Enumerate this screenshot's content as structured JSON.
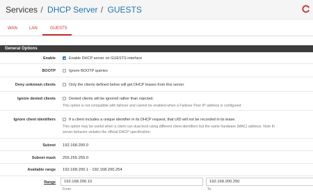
{
  "header": {
    "crumb_services": "Services",
    "crumb_sep": "/",
    "crumb_dhcp": "DHCP Server",
    "crumb_guests": "GUESTS",
    "reload_icon": "reload-icon"
  },
  "tabs": [
    {
      "label": "WAN"
    },
    {
      "label": "LAN"
    },
    {
      "label": "GUESTS"
    }
  ],
  "panel": {
    "title": "General Options"
  },
  "fields": {
    "enable": {
      "label": "Enable",
      "checked": true,
      "text": "Enable DHCP server on GUESTS interface"
    },
    "bootp": {
      "label": "BOOTP",
      "checked": false,
      "text": "Ignore BOOTP queries"
    },
    "deny_unknown": {
      "label": "Deny unknown clients",
      "checked": false,
      "text": "Only the clients defined below will get DHCP leases from this server."
    },
    "ignore_denied": {
      "label": "Ignore denied clients",
      "checked": false,
      "text": "Denied clients will be ignored rather than rejected.",
      "help": "This option is not compatible with failover and cannot be enabled when a Failover Peer IP address is configured."
    },
    "ignore_client_id": {
      "label": "Ignore client identifiers",
      "checked": false,
      "text": "If a client includes a unique identifier in its DHCP request, that UID will not be recorded in its lease.",
      "help1": "This option may be useful when a client can dual boot using different client identifiers but the same hardware (MAC) address. Note th",
      "help2": "server behavior violates the official DHCP specification."
    },
    "subnet": {
      "label": "Subnet",
      "value": "192.168.200.0"
    },
    "subnet_mask": {
      "label": "Subnet mask",
      "value": "255.255.255.0"
    },
    "available_range": {
      "label": "Available range",
      "value": "192.168.200.1 - 192.168.200.254"
    },
    "range": {
      "label": "Range",
      "from_value": "192.168.200.10",
      "to_value": "192.168.200.250",
      "from_label": "From",
      "to_label": "To"
    }
  },
  "colors": {
    "accent": "#c9302c",
    "link": "#1e73b8",
    "panel_header": "#3c3c3c"
  }
}
